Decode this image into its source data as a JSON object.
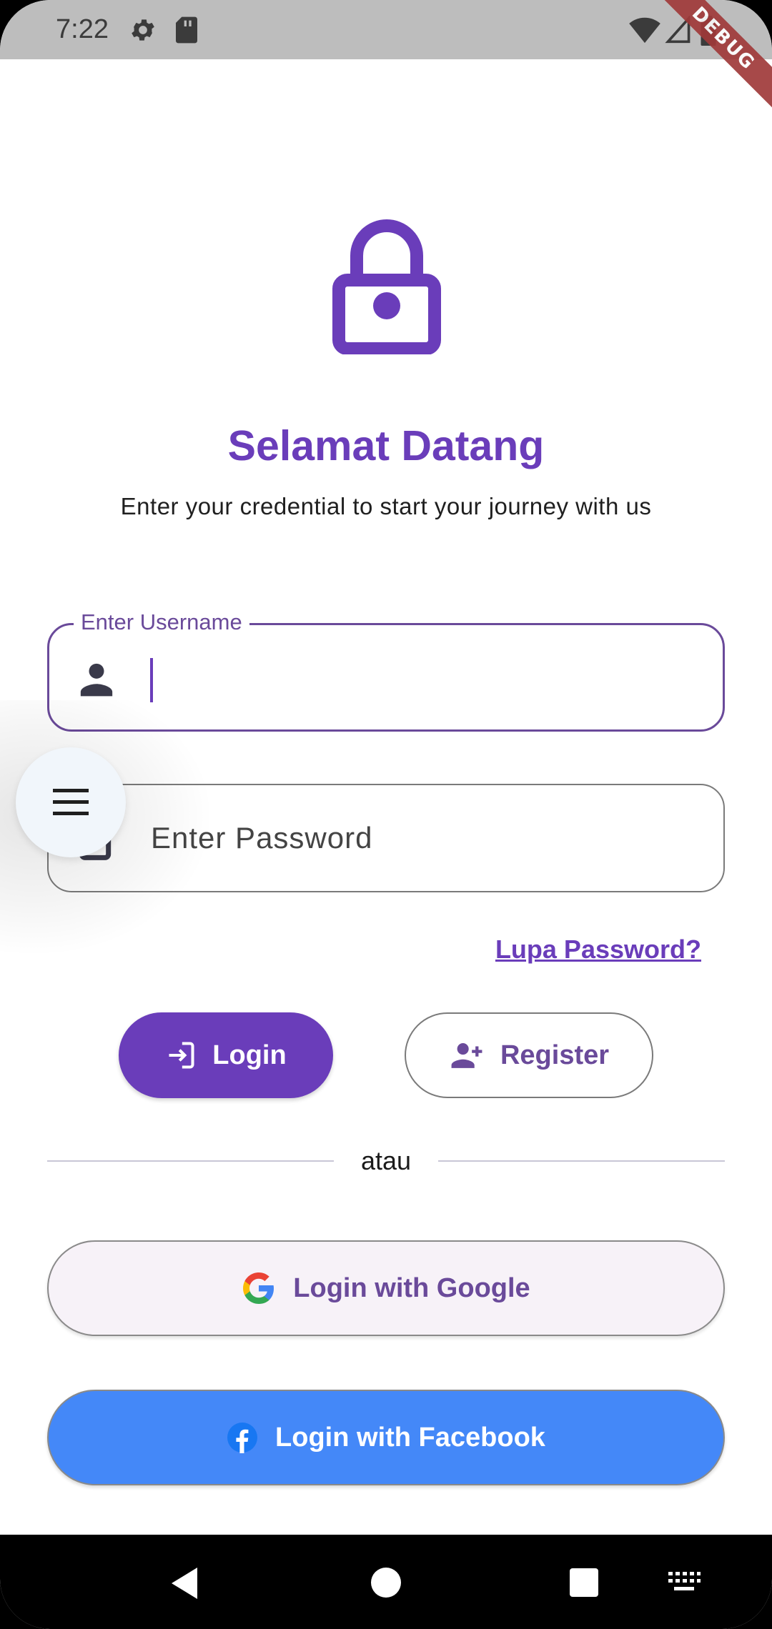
{
  "status_bar": {
    "time": "7:22",
    "icons": [
      "settings-icon",
      "sd-card-icon",
      "wifi-icon",
      "signal-icon",
      "battery-icon"
    ],
    "debug_banner": "DEBUG"
  },
  "header": {
    "icon": "lock-icon",
    "title": "Selamat Datang",
    "subtitle": "Enter your credential to start your journey with us"
  },
  "form": {
    "username": {
      "label": "Enter Username",
      "value": "",
      "icon": "person-icon"
    },
    "password": {
      "placeholder": "Enter Password",
      "icon": "lock-icon"
    },
    "forgot_password": "Lupa Password?"
  },
  "actions": {
    "login_label": "Login",
    "login_icon": "login-icon",
    "register_label": "Register",
    "register_icon": "person-add-icon"
  },
  "divider_text": "atau",
  "social": {
    "google_label": "Login with Google",
    "facebook_label": "Login with Facebook"
  },
  "fab": {
    "icon": "menu-icon"
  },
  "colors": {
    "primary": "#6a3dba",
    "google_bg": "#f7f2f8",
    "facebook_bg": "#4488f8",
    "status_bar": "#bdbdbd"
  }
}
